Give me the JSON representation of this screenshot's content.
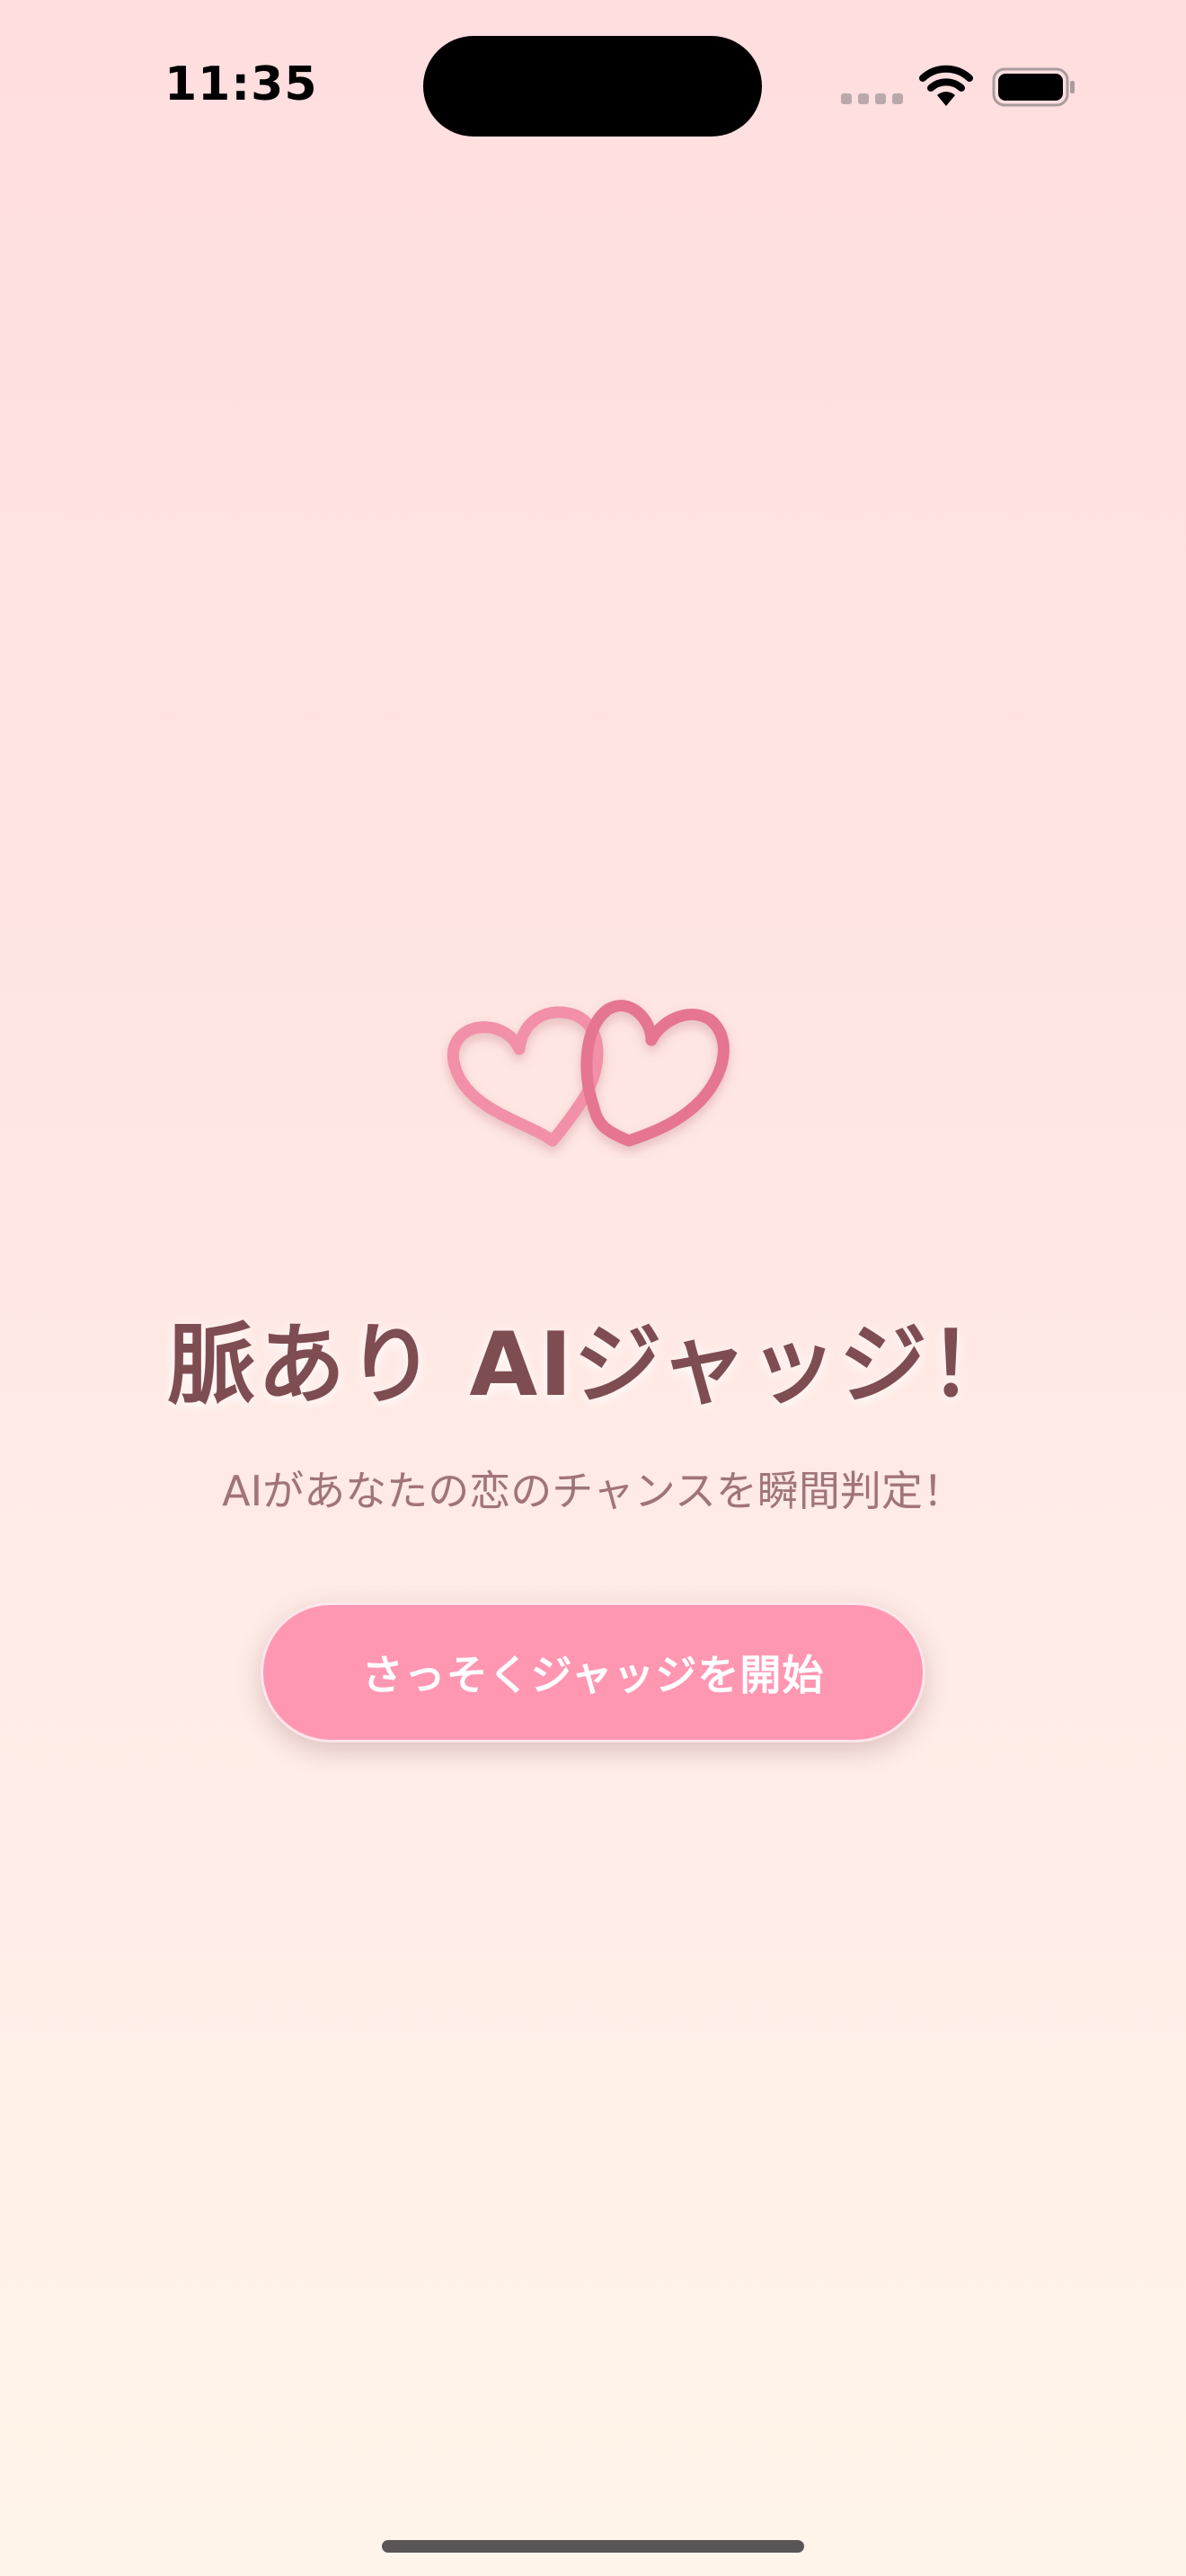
{
  "status_bar": {
    "time": "11:35",
    "icons": [
      "signal-icon",
      "wifi-icon",
      "battery-icon"
    ]
  },
  "hero": {
    "icon": "hearts-icon",
    "title": "脈あり AIジャッジ！",
    "subtitle": "AIがあなたの恋のチャンスを瞬間判定！",
    "start_button_label": "さっそくジャッジを開始"
  },
  "colors": {
    "title": "#7E4D51",
    "subtitle": "#A07478",
    "button": "#FF97B3",
    "heart_light": "#F190A8",
    "heart_dark": "#E57490"
  }
}
